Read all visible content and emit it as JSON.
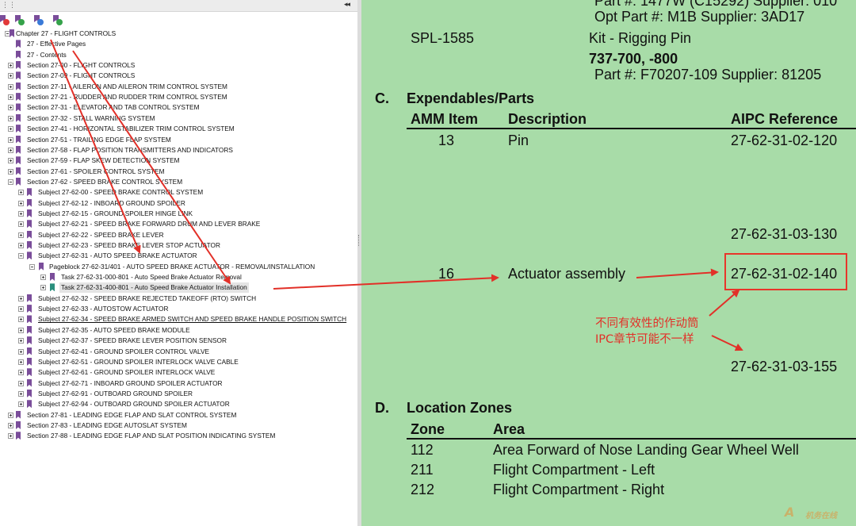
{
  "left_panel": {
    "grip": "⋮⋮",
    "collapse": "◂◂",
    "toolbar": [
      {
        "name": "bookmark-delete-icon",
        "badge": "#e23a3a"
      },
      {
        "name": "bookmark-expand-icon",
        "badge": "#35a24a"
      },
      {
        "name": "bookmark-new-icon",
        "badge": "#3a7ad8"
      },
      {
        "name": "bookmark-find-icon",
        "badge": "#35a24a"
      }
    ],
    "tree": [
      {
        "label": "Chapter 27 - FLIGHT CONTROLS",
        "level": 0,
        "expander": "minus"
      },
      {
        "label": "27 - Effective Pages",
        "level": 1,
        "expander": "none"
      },
      {
        "label": "27 - Contents",
        "level": 1,
        "expander": "none"
      },
      {
        "label": "Section 27-00 - FLIGHT CONTROLS",
        "level": 1,
        "expander": "plus"
      },
      {
        "label": "Section 27-09 - FLIGHT CONTROLS",
        "level": 1,
        "expander": "plus"
      },
      {
        "label": "Section 27-11 - AILERON AND AILERON TRIM CONTROL SYSTEM",
        "level": 1,
        "expander": "plus"
      },
      {
        "label": "Section 27-21 - RUDDER AND RUDDER TRIM CONTROL SYSTEM",
        "level": 1,
        "expander": "plus"
      },
      {
        "label": "Section 27-31 - ELEVATOR AND TAB CONTROL SYSTEM",
        "level": 1,
        "expander": "plus"
      },
      {
        "label": "Section 27-32 - STALL WARNING SYSTEM",
        "level": 1,
        "expander": "plus"
      },
      {
        "label": "Section 27-41 - HORIZONTAL STABILIZER TRIM CONTROL SYSTEM",
        "level": 1,
        "expander": "plus"
      },
      {
        "label": "Section 27-51 - TRAILING EDGE FLAP SYSTEM",
        "level": 1,
        "expander": "plus"
      },
      {
        "label": "Section 27-58 - FLAP POSITION TRANSMITTERS AND INDICATORS",
        "level": 1,
        "expander": "plus"
      },
      {
        "label": "Section 27-59 - FLAP SKEW DETECTION SYSTEM",
        "level": 1,
        "expander": "plus"
      },
      {
        "label": "Section 27-61 - SPOILER CONTROL SYSTEM",
        "level": 1,
        "expander": "plus"
      },
      {
        "label": "Section 27-62 - SPEED BRAKE CONTROL SYSTEM",
        "level": 1,
        "expander": "minus"
      },
      {
        "label": "Subject 27-62-00 - SPEED BRAKE CONTROL SYSTEM",
        "level": 2,
        "expander": "plus"
      },
      {
        "label": "Subject 27-62-12 - INBOARD GROUND SPOILER",
        "level": 2,
        "expander": "plus"
      },
      {
        "label": "Subject 27-62-15 - GROUND SPOILER HINGE LINK",
        "level": 2,
        "expander": "plus"
      },
      {
        "label": "Subject 27-62-21 - SPEED BRAKE FORWARD DRUM AND LEVER BRAKE",
        "level": 2,
        "expander": "plus"
      },
      {
        "label": "Subject 27-62-22 - SPEED BRAKE LEVER",
        "level": 2,
        "expander": "plus"
      },
      {
        "label": "Subject 27-62-23 - SPEED BRAKE LEVER STOP ACTUATOR",
        "level": 2,
        "expander": "plus"
      },
      {
        "label": "Subject 27-62-31 - AUTO SPEED BRAKE ACTUATOR",
        "level": 2,
        "expander": "minus"
      },
      {
        "label": "Pageblock 27-62-31/401 - AUTO SPEED BRAKE ACTUATOR - REMOVAL/INSTALLATION",
        "level": 3,
        "expander": "minus"
      },
      {
        "label": "Task 27-62-31-000-801 - Auto Speed Brake Actuator Removal",
        "level": 4,
        "expander": "plus"
      },
      {
        "label": "Task 27-62-31-400-801 - Auto Speed Brake Actuator Installation",
        "level": 4,
        "expander": "plus",
        "selected": true,
        "teal": true
      },
      {
        "label": "Subject 27-62-32 - SPEED BRAKE REJECTED TAKEOFF (RTO) SWITCH",
        "level": 2,
        "expander": "plus"
      },
      {
        "label": "Subject 27-62-33 - AUTOSTOW ACTUATOR",
        "level": 2,
        "expander": "plus"
      },
      {
        "label": "Subject 27-62-34 - SPEED BRAKE ARMED SWITCH AND SPEED BRAKE HANDLE POSITION SWITCH",
        "level": 2,
        "expander": "plus",
        "underline": true
      },
      {
        "label": "Subject 27-62-35 - AUTO SPEED BRAKE MODULE",
        "level": 2,
        "expander": "plus"
      },
      {
        "label": "Subject 27-62-37 - SPEED BRAKE LEVER POSITION SENSOR",
        "level": 2,
        "expander": "plus"
      },
      {
        "label": "Subject 27-62-41 - GROUND SPOILER CONTROL VALVE",
        "level": 2,
        "expander": "plus"
      },
      {
        "label": "Subject 27-62-51 - GROUND SPOILER INTERLOCK VALVE CABLE",
        "level": 2,
        "expander": "plus"
      },
      {
        "label": "Subject 27-62-61 - GROUND SPOILER INTERLOCK VALVE",
        "level": 2,
        "expander": "plus"
      },
      {
        "label": "Subject 27-62-71 - INBOARD GROUND SPOILER ACTUATOR",
        "level": 2,
        "expander": "plus"
      },
      {
        "label": "Subject 27-62-91 - OUTBOARD GROUND SPOILER",
        "level": 2,
        "expander": "plus"
      },
      {
        "label": "Subject 27-62-94 - OUTBOARD GROUND SPOILER ACTUATOR",
        "level": 2,
        "expander": "plus"
      },
      {
        "label": "Section 27-81 - LEADING EDGE FLAP AND SLAT CONTROL SYSTEM",
        "level": 1,
        "expander": "plus"
      },
      {
        "label": "Section 27-83 - LEADING EDGE AUTOSLAT SYSTEM",
        "level": 1,
        "expander": "plus"
      },
      {
        "label": "Section 27-88 - LEADING EDGE FLAP AND SLAT POSITION INDICATING SYSTEM",
        "level": 1,
        "expander": "plus"
      }
    ]
  },
  "document": {
    "top_partial_1": "Part #: 1477W (C15292)   Supplier: 010",
    "top_partial_2": "Opt Part #: M1B   Supplier: 3AD17",
    "tool_number": "SPL-1585",
    "tool_desc": "Kit - Rigging Pin",
    "effectivity": "737-700, -800",
    "part_line": "Part #: F70207-109   Supplier: 81205",
    "section_c": {
      "letter": "C.",
      "title": "Expendables/Parts",
      "headers": {
        "item": "AMM Item",
        "desc": "Description",
        "ref": "AIPC Reference"
      },
      "rows": [
        {
          "item": "13",
          "desc": "Pin",
          "ref": "27-62-31-02-120"
        },
        {
          "item": "",
          "desc": "",
          "ref": "27-62-31-03-130"
        },
        {
          "item": "16",
          "desc": "Actuator assembly",
          "ref": "27-62-31-02-140"
        },
        {
          "item": "",
          "desc": "",
          "ref": "27-62-31-03-155"
        }
      ]
    },
    "section_d": {
      "letter": "D.",
      "title": "Location Zones",
      "headers": {
        "zone": "Zone",
        "area": "Area"
      },
      "rows": [
        {
          "zone": "112",
          "area": "Area Forward of Nose Landing Gear Wheel Well"
        },
        {
          "zone": "211",
          "area": "Flight Compartment - Left"
        },
        {
          "zone": "212",
          "area": "Flight Compartment - Right"
        }
      ]
    }
  },
  "annotation": {
    "line1": "不同有效性的作动筒",
    "line2": "IPC章节可能不一样",
    "color": "#e23028"
  },
  "watermark": {
    "mark": "A",
    "text": "机务在线"
  },
  "colors": {
    "doc_bg": "#a8dca8",
    "bookmark": "#7a4d9a",
    "bookmark_selected": "#2a8f7d"
  }
}
